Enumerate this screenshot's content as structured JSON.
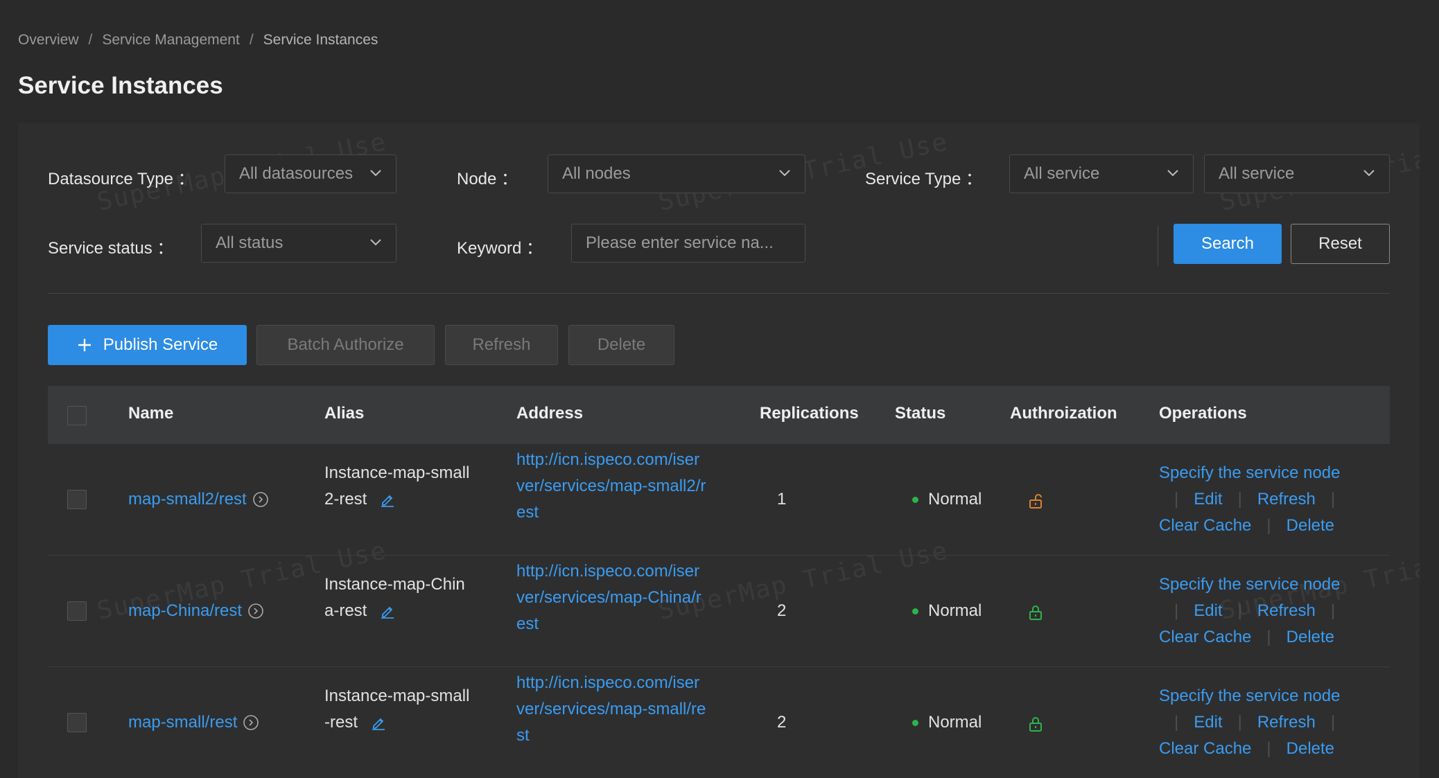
{
  "breadcrumb": {
    "items": [
      "Overview",
      "Service Management",
      "Service Instances"
    ],
    "separator": "/"
  },
  "page_title": "Service Instances",
  "watermark_text": "SuperMap Trial Use",
  "filters": {
    "datasource_type": {
      "label": "Datasource Type",
      "value": "All datasources"
    },
    "node": {
      "label": "Node",
      "value": "All nodes"
    },
    "service_type": {
      "label": "Service Type",
      "value": "All service",
      "value2": "All service"
    },
    "service_status": {
      "label": "Service status",
      "value": "All status"
    },
    "keyword": {
      "label": "Keyword",
      "placeholder": "Please enter service na..."
    },
    "colon": "：",
    "search_label": "Search",
    "reset_label": "Reset"
  },
  "toolbar": {
    "publish_label": "Publish Service",
    "batch_authorize_label": "Batch Authorize",
    "refresh_label": "Refresh",
    "delete_label": "Delete"
  },
  "table": {
    "columns": [
      "Name",
      "Alias",
      "Address",
      "Replications",
      "Status",
      "Authroization",
      "Operations"
    ],
    "rows": [
      {
        "name": "map-small2/rest",
        "alias_line1": "Instance-map-small",
        "alias_line2": "2-rest",
        "address_lines": [
          "http://icn.ispeco.com/iser",
          "ver/services/map-small2/r",
          "est"
        ],
        "replications": "1",
        "status": "Normal",
        "authorization": "unlocked"
      },
      {
        "name": "map-China/rest",
        "alias_line1": "Instance-map-Chin",
        "alias_line2": "a-rest",
        "address_lines": [
          "http://icn.ispeco.com/iser",
          "ver/services/map-China/r",
          "est"
        ],
        "replications": "2",
        "status": "Normal",
        "authorization": "locked"
      },
      {
        "name": "map-small/rest",
        "alias_line1": "Instance-map-small",
        "alias_line2": "-rest",
        "address_lines": [
          "http://icn.ispeco.com/iser",
          "ver/services/map-small/re",
          "st"
        ],
        "replications": "2",
        "status": "Normal",
        "authorization": "locked"
      }
    ],
    "operations": {
      "specify": "Specify the service node",
      "edit": "Edit",
      "refresh": "Refresh",
      "clear_cache": "Clear Cache",
      "delete": "Delete",
      "separator": "|"
    }
  },
  "colors": {
    "accent": "#2d8ce3",
    "link": "#3a9cf0",
    "status_normal": "#2fb34a",
    "unlocked": "#d9822b",
    "locked": "#2fb34a"
  },
  "icons": {
    "plus": "plus-icon",
    "chevron": "chevron-down-icon",
    "circle_arrow": "circle-arrow-right-icon",
    "edit": "edit-pencil-icon",
    "lock_open": "lock-open-icon",
    "lock_closed": "lock-closed-icon"
  }
}
